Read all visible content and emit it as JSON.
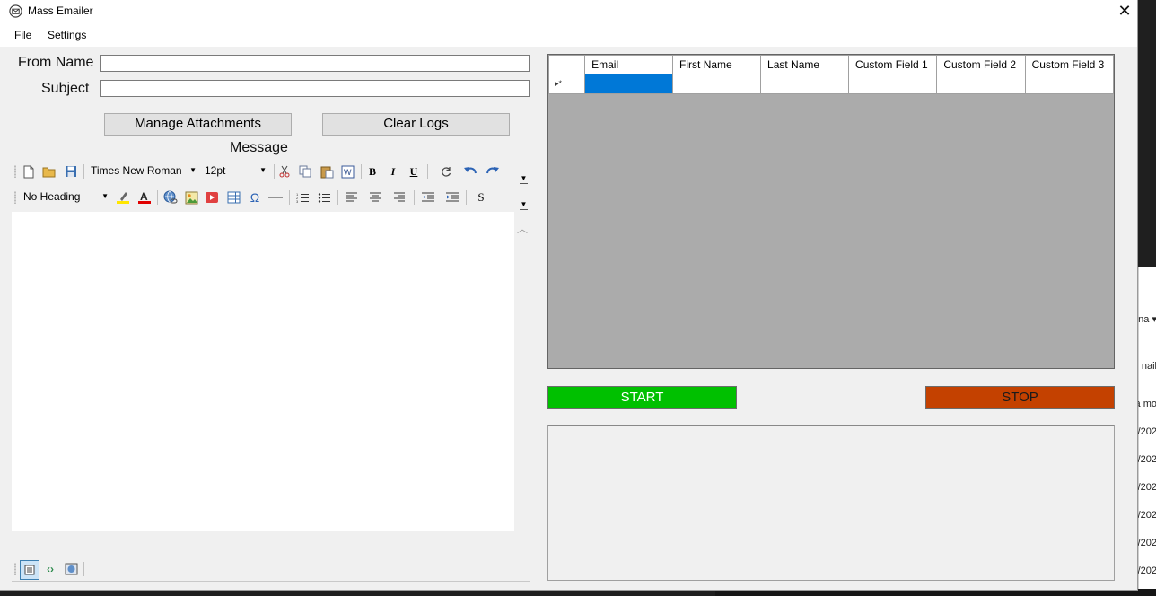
{
  "window": {
    "title": "Mass Emailer",
    "close_symbol": "✕"
  },
  "menu": {
    "file": "File",
    "settings": "Settings"
  },
  "form": {
    "from_name_label": "From Name",
    "subject_label": "Subject",
    "from_name_value": "",
    "subject_value": ""
  },
  "buttons": {
    "manage_attachments": "Manage Attachments",
    "clear_logs": "Clear Logs",
    "start": "START",
    "stop": "STOP"
  },
  "message_label": "Message",
  "toolbar": {
    "font_name": "Times New Roman",
    "font_size": "12pt",
    "heading": "No Heading"
  },
  "grid": {
    "columns": [
      "Email",
      "First Name",
      "Last Name",
      "Custom Field 1",
      "Custom Field 2",
      "Custom Field 3"
    ],
    "new_row_marker": "▸*"
  },
  "background_right": [
    "na ▾",
    "nail",
    "a mo",
    "/202",
    "/202",
    "/202",
    "/202",
    "/202",
    "/202"
  ],
  "colors": {
    "start": "#00c000",
    "stop": "#c44100",
    "selection": "#0078d7",
    "grid_bg": "#ababab"
  }
}
